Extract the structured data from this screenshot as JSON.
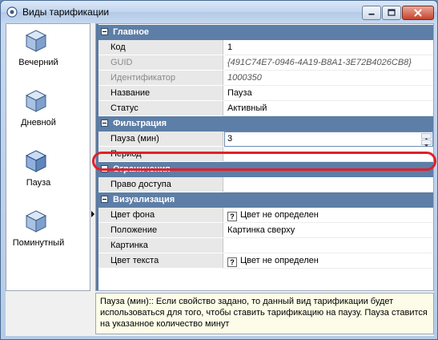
{
  "window": {
    "title": "Виды тарификации"
  },
  "sidebar": {
    "items": [
      {
        "label": "Вечерний",
        "selected": false
      },
      {
        "label": "Дневной",
        "selected": false
      },
      {
        "label": "Пауза",
        "selected": true
      },
      {
        "label": "Поминутный",
        "selected": false
      }
    ]
  },
  "grid": {
    "categories": {
      "main": "Главное",
      "filter": "Фильтрация",
      "limits": "Ограничения",
      "visual": "Визуализация"
    },
    "main": {
      "code_label": "Код",
      "code_value": "1",
      "guid_label": "GUID",
      "guid_value": "{491C74E7-0946-4A19-B8A1-3E72B4026CB8}",
      "id_label": "Идентификатор",
      "id_value": "1000350",
      "name_label": "Название",
      "name_value": "Пауза",
      "status_label": "Статус",
      "status_value": "Активный"
    },
    "filter": {
      "pause_label": "Пауза (мин)",
      "pause_value": "3",
      "period_label": "Период",
      "period_value": ""
    },
    "limits": {
      "access_label": "Право доступа",
      "access_value": ""
    },
    "visual": {
      "bgcolor_label": "Цвет фона",
      "bgcolor_value": "Цвет не определен",
      "position_label": "Положение",
      "position_value": "Картинка сверху",
      "picture_label": "Картинка",
      "picture_value": "",
      "textcolor_label": "Цвет текста",
      "textcolor_value": "Цвет не определен"
    },
    "qbox_glyph": "?"
  },
  "description": "Пауза (мин):: Если свойство задано, то данный вид тарификации будет использоваться для того, чтобы ставить тарификацию на паузу. Пауза ставится на указанное количество минут",
  "colors": {
    "category_header": "#5d7ea6",
    "highlight": "#e0202a",
    "description_bg": "#fcfce8"
  },
  "icons": {
    "tariff": "cube-icon",
    "app": "app-icon"
  }
}
